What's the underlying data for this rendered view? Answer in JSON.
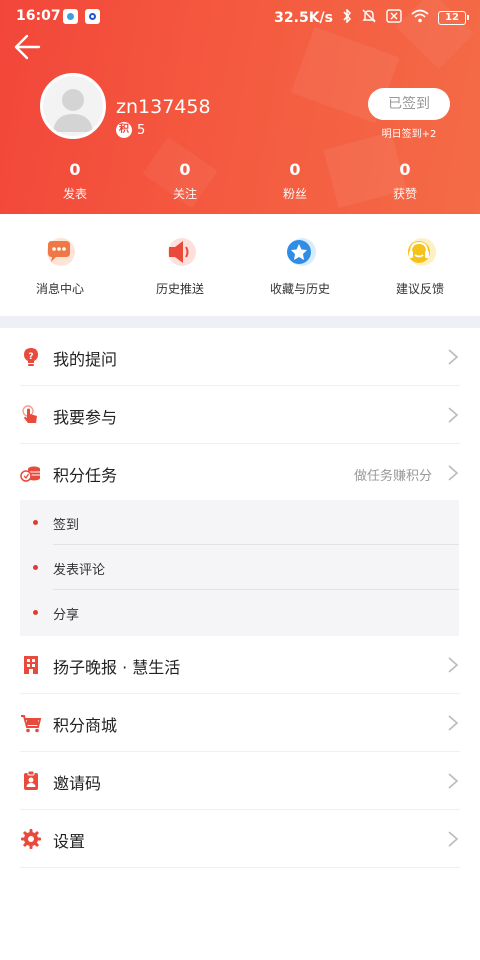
{
  "status_bar": {
    "time": "16:07",
    "speed": "32.5K/s",
    "battery": "12"
  },
  "profile": {
    "username": "zn137458",
    "points_badge": "积",
    "points": "5",
    "signin_label": "已签到",
    "signin_hint": "明日签到+2"
  },
  "stats": [
    {
      "value": "0",
      "label": "发表"
    },
    {
      "value": "0",
      "label": "关注"
    },
    {
      "value": "0",
      "label": "粉丝"
    },
    {
      "value": "0",
      "label": "获赞"
    }
  ],
  "quick_actions": [
    {
      "label": "消息中心",
      "icon": "message-icon"
    },
    {
      "label": "历史推送",
      "icon": "broadcast-icon"
    },
    {
      "label": "收藏与历史",
      "icon": "star-icon"
    },
    {
      "label": "建议反馈",
      "icon": "headset-icon"
    }
  ],
  "menu": [
    {
      "label": "我的提问",
      "icon": "bulb-icon",
      "hint": ""
    },
    {
      "label": "我要参与",
      "icon": "tap-icon",
      "hint": ""
    },
    {
      "label": "积分任务",
      "icon": "coins-icon",
      "hint": "做任务赚积分"
    },
    {
      "label": "扬子晚报 · 慧生活",
      "icon": "building-icon",
      "hint": ""
    },
    {
      "label": "积分商城",
      "icon": "cart-icon",
      "hint": ""
    },
    {
      "label": "邀请码",
      "icon": "badge-icon",
      "hint": ""
    },
    {
      "label": "设置",
      "icon": "gear-icon",
      "hint": ""
    }
  ],
  "tasks": [
    {
      "label": "签到"
    },
    {
      "label": "发表评论"
    },
    {
      "label": "分享"
    }
  ],
  "colors": {
    "accent": "#e8443a",
    "header_start": "#f2463a",
    "header_end": "#f46b47"
  }
}
